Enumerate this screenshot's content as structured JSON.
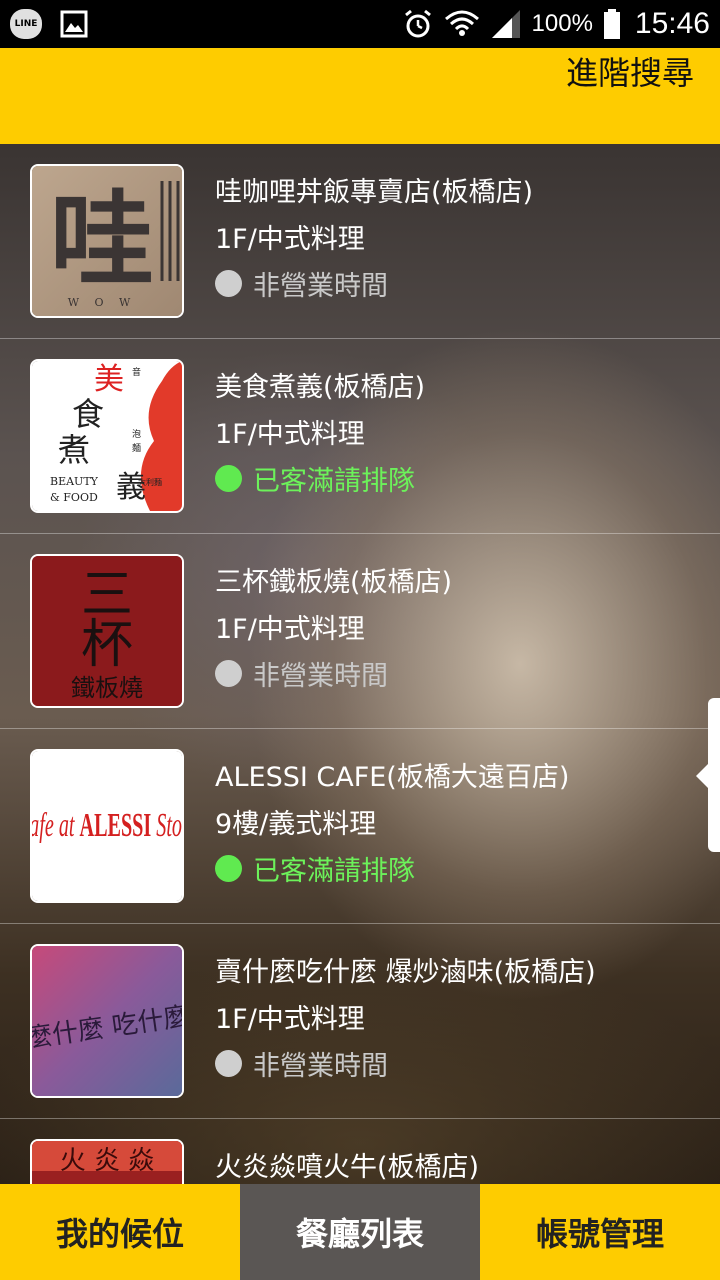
{
  "status_bar": {
    "line_label": "LINE",
    "battery": "100%",
    "clock": "15:46"
  },
  "header": {
    "advanced_search": "進階搜尋"
  },
  "restaurants": [
    {
      "name": "哇咖哩丼飯專賣店(板橋店)",
      "floor_type": "1F/中式料理",
      "status": "非營業時間",
      "status_kind": "closed",
      "logo": {
        "kind": "wow",
        "main_char": "哇",
        "sub": "W O W"
      }
    },
    {
      "name": "美食煮義(板橋店)",
      "floor_type": "1F/中式料理",
      "status": "已客滿請排隊",
      "status_kind": "full",
      "logo": {
        "kind": "meishi",
        "chars": [
          "美",
          "食",
          "煮",
          "義"
        ],
        "small": [
          "音",
          "泡",
          "麵",
          "大利麵"
        ],
        "en": [
          "BEAUTY",
          "& FOOD"
        ]
      }
    },
    {
      "name": "三杯鐵板燒(板橋店)",
      "floor_type": "1F/中式料理",
      "status": "非營業時間",
      "status_kind": "closed",
      "logo": {
        "kind": "sanbei",
        "chars": [
          "三",
          "杯"
        ],
        "sub": "鐵板燒"
      }
    },
    {
      "name": "ALESSI CAFE(板橋大遠百店)",
      "floor_type": "9樓/義式料理",
      "status": "已客滿請排隊",
      "status_kind": "full",
      "logo": {
        "kind": "alessi",
        "text_a": "Cafe at ",
        "text_b": "ALESSI",
        "text_c": " Store"
      }
    },
    {
      "name": "賣什麼吃什麼 爆炒滷味(板橋店)",
      "floor_type": "1F/中式料理",
      "status": "非營業時間",
      "status_kind": "closed",
      "logo": {
        "kind": "maishenme",
        "text": "麼什麼 吃什麼"
      }
    },
    {
      "name": "火炎焱噴火牛(板橋店)",
      "floor_type": "",
      "status": "",
      "status_kind": "",
      "logo": {
        "kind": "fire",
        "text": "火 炎 焱"
      }
    }
  ],
  "tabs": [
    {
      "label": "我的候位",
      "active": false
    },
    {
      "label": "餐廳列表",
      "active": true
    },
    {
      "label": "帳號管理",
      "active": false
    }
  ],
  "colors": {
    "accent_yellow": "#fecc00",
    "status_full": "#6cf25a",
    "status_closed": "#c9c9c9",
    "tab_active_bg": "#5a5654"
  }
}
